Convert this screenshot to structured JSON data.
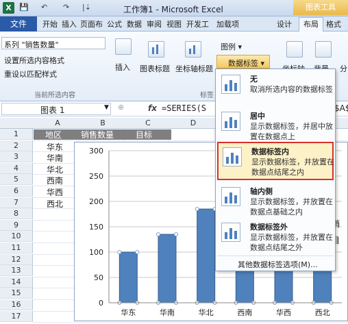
{
  "window": {
    "title": "工作簿1 - Microsoft Excel",
    "chart_tools": "图表工具",
    "app_icon": "X"
  },
  "quick_access": {
    "save": "💾",
    "undo": "↶",
    "redo": "↷",
    "customize": "|⇣"
  },
  "tabs": [
    "文件",
    "开始",
    "插入",
    "页面布",
    "公式",
    "数据",
    "审阅",
    "视图",
    "开发工",
    "加载项",
    "设计",
    "布局",
    "格式"
  ],
  "ribbon": {
    "selection_combo": "系列 \"销售数量\"",
    "format_selection": "设置所选内容格式",
    "reset_match": "重设以匹配样式",
    "group_current": "当前所选内容",
    "insert": "插入",
    "chart_title": "图表标题",
    "axis_title": "坐标轴标题",
    "legend": "图例 ▾",
    "data_labels": "数据标签 ▾",
    "group_labels": "标签",
    "axes": "坐标轴",
    "background": "背景",
    "analysis": "分"
  },
  "formula_bar": {
    "name_box": "图表 1",
    "fx": "fx",
    "formula": "=SERIES(S",
    "formula_tail": "$A$"
  },
  "columns": [
    "A",
    "B",
    "C",
    "D"
  ],
  "rows": [
    "1",
    "2",
    "3",
    "4",
    "5",
    "6",
    "7",
    "8",
    "9",
    "10",
    "11",
    "12",
    "13",
    "14",
    "15",
    "16",
    "17"
  ],
  "sheet": {
    "header": [
      "地区",
      "销售数量",
      "目标"
    ],
    "regions": [
      "华东",
      "华南",
      "华北",
      "西南",
      "华西",
      "西北"
    ]
  },
  "menu": {
    "items": [
      {
        "title": "无",
        "desc": "取消所选内容的数据标签"
      },
      {
        "title": "居中",
        "desc": "显示数据标签，并居中放置在数据点上"
      },
      {
        "title": "数据标签内",
        "desc": "显示数据标签，并放置在数据点结尾之内"
      },
      {
        "title": "轴内侧",
        "desc": "显示数据标签，并放置在数据点基础之内"
      },
      {
        "title": "数据标签外",
        "desc": "显示数据标签，并放置在数据点结尾之外"
      }
    ],
    "more": "其他数据标签选项(M)..."
  },
  "legend_fragments": [
    "销",
    "目"
  ],
  "chart_data": {
    "type": "bar",
    "categories": [
      "华东",
      "华南",
      "华北",
      "西南",
      "华西",
      "西北"
    ],
    "series": [
      {
        "name": "销售数量",
        "values": [
          100,
          135,
          185,
          210,
          150,
          165
        ],
        "color": "#4f81bd"
      }
    ],
    "title": "",
    "xlabel": "",
    "ylabel": "",
    "ylim": [
      0,
      300
    ],
    "yticks": [
      "0",
      "50",
      "100",
      "150",
      "200",
      "250",
      "300"
    ]
  }
}
